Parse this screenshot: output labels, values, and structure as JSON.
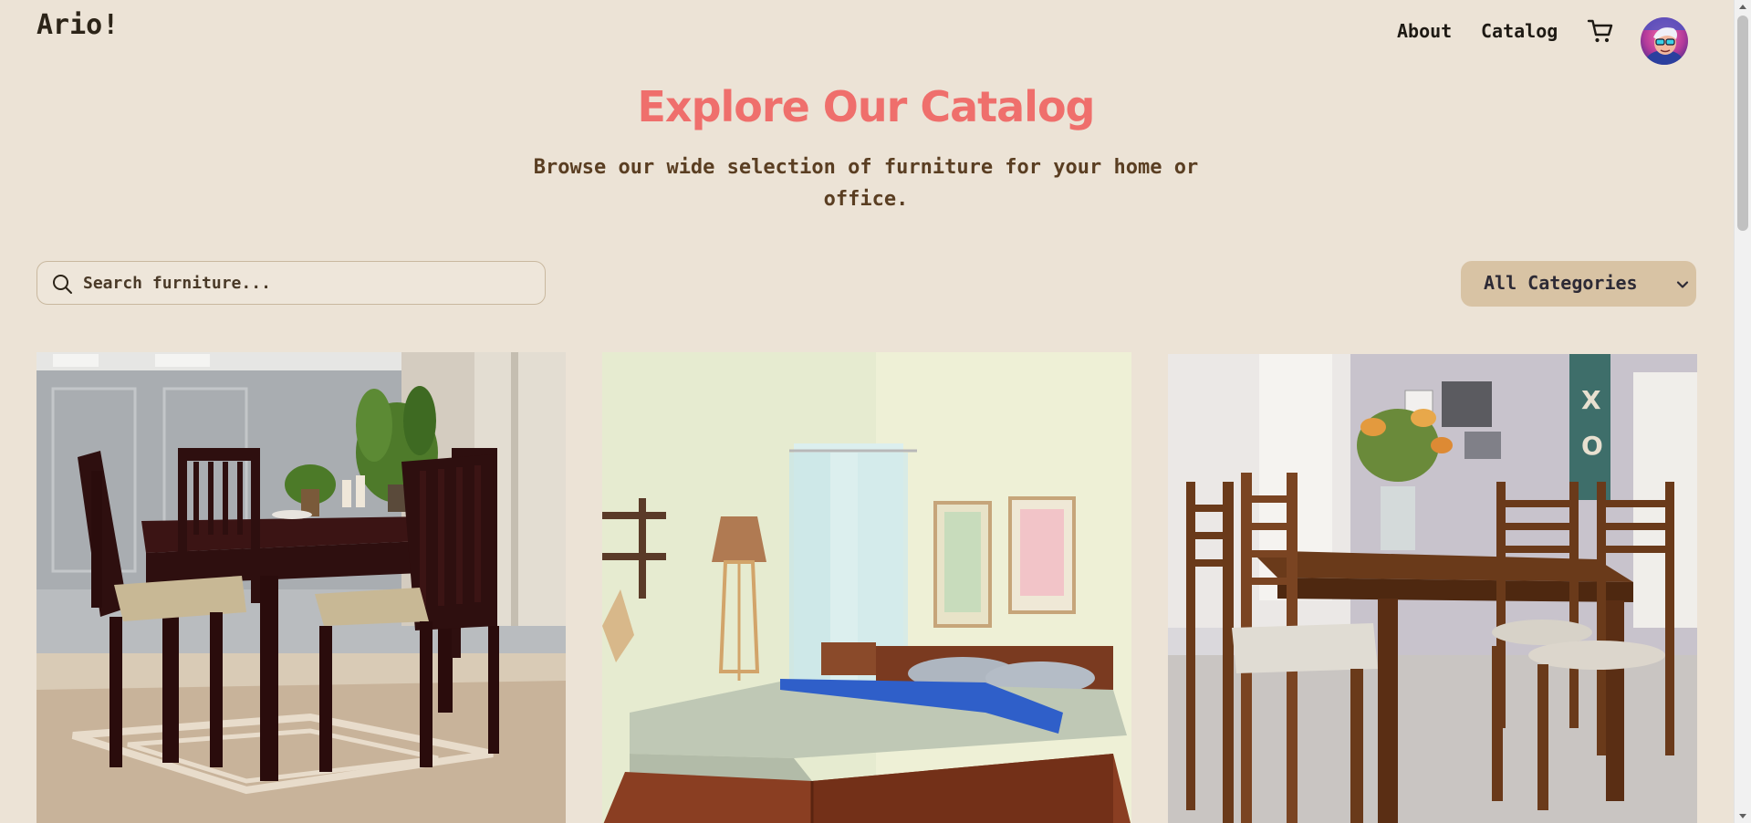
{
  "header": {
    "logo": "Ario!",
    "nav": {
      "about": "About",
      "catalog": "Catalog"
    },
    "icons": [
      "shopping-cart-icon",
      "user-avatar"
    ]
  },
  "hero": {
    "title": "Explore Our Catalog",
    "subtitle": "Browse our wide selection of furniture for your home or office."
  },
  "controls": {
    "search_placeholder": "Search furniture...",
    "search_value": "",
    "category_selected": "All Categories"
  },
  "products": [
    {
      "image": "dark wooden dining table with four chairs"
    },
    {
      "image": "wooden bed with grey bedding in bright bedroom"
    },
    {
      "image": "teak dining table with chairs and flower vase"
    }
  ],
  "colors": {
    "background": "#ece3d6",
    "accent": "#ef6f6c",
    "subtitle": "#5a3e22",
    "select_bg": "#d8c3a4"
  }
}
